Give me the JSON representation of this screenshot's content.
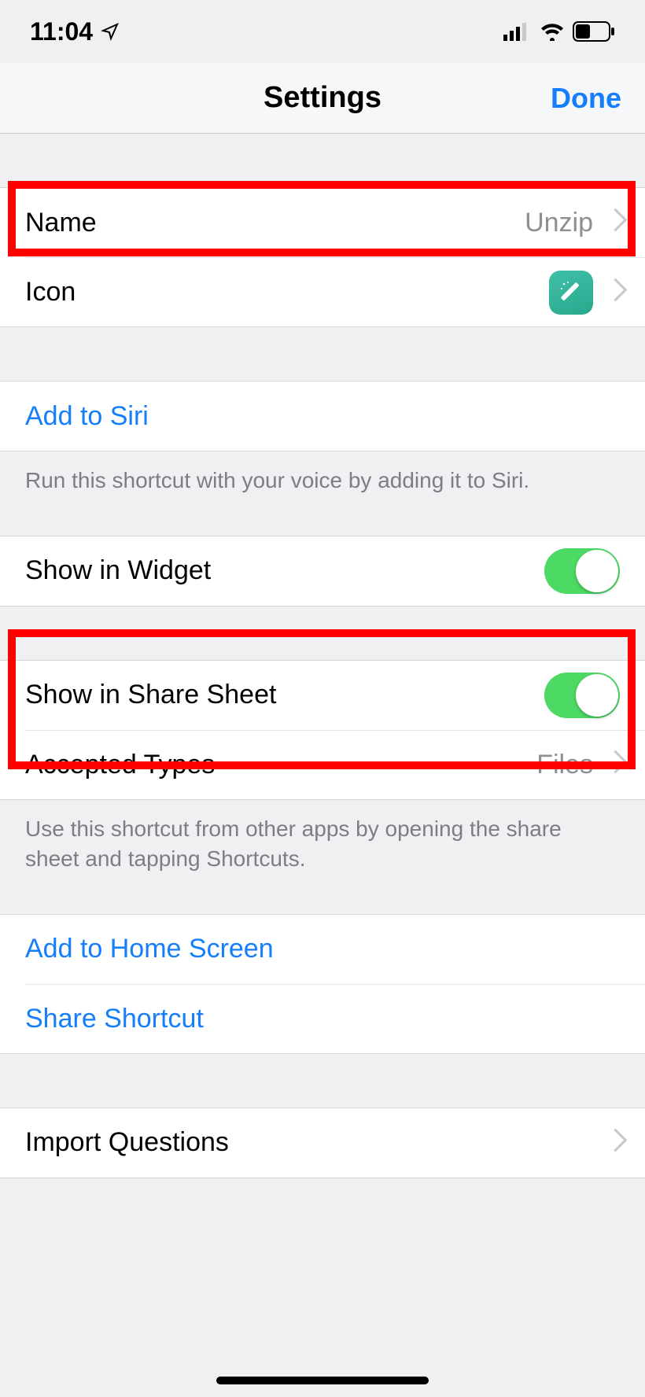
{
  "status": {
    "time": "11:04"
  },
  "nav": {
    "title": "Settings",
    "done": "Done"
  },
  "rows": {
    "name_label": "Name",
    "name_value": "Unzip",
    "icon_label": "Icon",
    "siri_label": "Add to Siri",
    "siri_footer": "Run this shortcut with your voice by adding it to Siri.",
    "widget_label": "Show in Widget",
    "widget_on": true,
    "share_sheet_label": "Show in Share Sheet",
    "share_sheet_on": true,
    "accepted_types_label": "Accepted Types",
    "accepted_types_value": "Files",
    "share_sheet_footer": "Use this shortcut from other apps by opening the share sheet and tapping Shortcuts.",
    "add_home_label": "Add to Home Screen",
    "share_shortcut_label": "Share Shortcut",
    "import_questions_label": "Import Questions"
  }
}
